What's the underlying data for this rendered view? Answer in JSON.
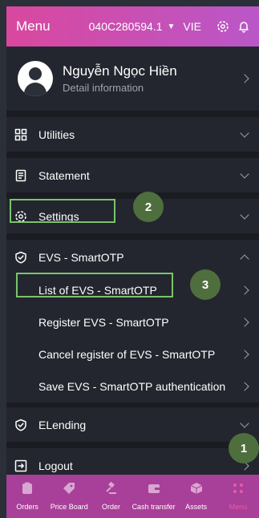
{
  "header": {
    "title": "Menu",
    "account": "040C280594.1",
    "language": "VIE"
  },
  "profile": {
    "name": "Nguyễn Ngọc Hiền",
    "detail": "Detail information"
  },
  "menu": {
    "utilities": "Utilities",
    "statement": "Statement",
    "settings": "Settings",
    "evs": {
      "label": "EVS - SmartOTP",
      "items": [
        "List of EVS - SmartOTP",
        "Register EVS - SmartOTP",
        "Cancel register of EVS - SmartOTP",
        "Save EVS - SmartOTP authentication"
      ]
    },
    "elending": "ELending",
    "logout": "Logout"
  },
  "steps": [
    "1",
    "2",
    "3"
  ],
  "bottom_nav": [
    {
      "label": "Orders",
      "icon": "clipboard-icon"
    },
    {
      "label": "Price Board",
      "icon": "tag-icon"
    },
    {
      "label": "Order",
      "icon": "gavel-icon"
    },
    {
      "label": "Cash transfer",
      "icon": "wallet-icon"
    },
    {
      "label": "Assets",
      "icon": "cube-icon"
    },
    {
      "label": "Menu",
      "icon": "grid-dots-icon",
      "active": true
    }
  ],
  "colors": {
    "header_start": "#d9489e",
    "header_end": "#b957c8",
    "bottom_nav": "#a83f98",
    "highlight": "#7bc36a",
    "badge": "#4f6e3d",
    "menu_active": "#e85aa6"
  }
}
